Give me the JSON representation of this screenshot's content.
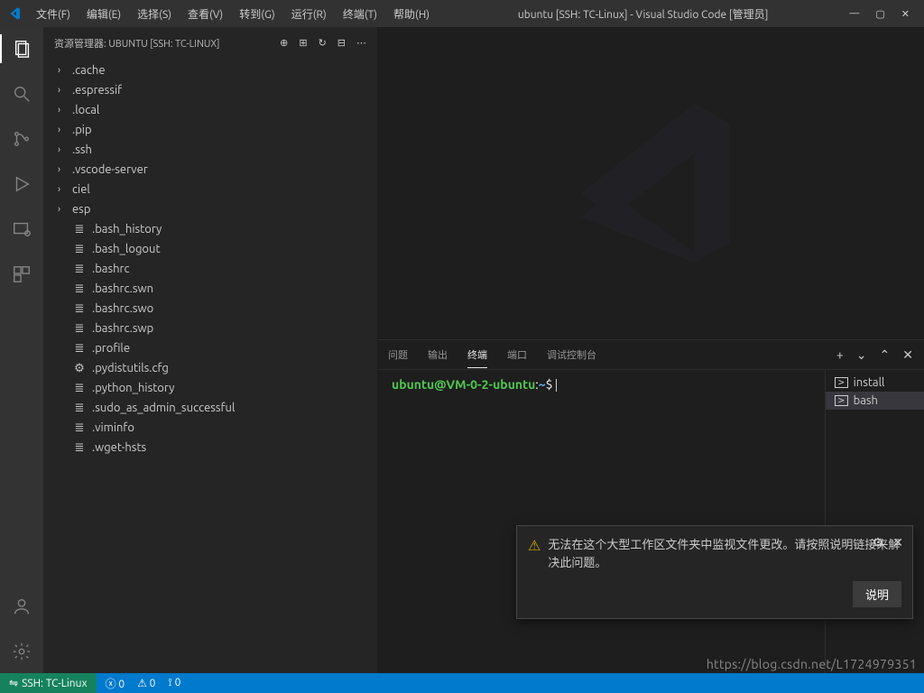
{
  "titlebar": {
    "title": "ubuntu [SSH: TC-Linux] - Visual Studio Code [管理员]",
    "menus": [
      "文件(F)",
      "编辑(E)",
      "选择(S)",
      "查看(V)",
      "转到(G)",
      "运行(R)",
      "终端(T)",
      "帮助(H)"
    ]
  },
  "sidebar": {
    "header": "资源管理器: UBUNTU [SSH: TC-LINUX]",
    "folders": [
      ".cache",
      ".espressif",
      ".local",
      ".pip",
      ".ssh",
      ".vscode-server",
      "ciel",
      "esp"
    ],
    "files": [
      ".bash_history",
      ".bash_logout",
      ".bashrc",
      ".bashrc.swn",
      ".bashrc.swo",
      ".bashrc.swp",
      ".profile",
      ".pydistutils.cfg",
      ".python_history",
      ".sudo_as_admin_successful",
      ".viminfo",
      ".wget-hsts"
    ]
  },
  "panel": {
    "tabs": {
      "problems": "问题",
      "output": "输出",
      "terminal": "终端",
      "ports": "端口",
      "debugconsole": "调试控制台"
    },
    "terminal": {
      "prompt_user": "ubuntu@VM-0-2-ubuntu",
      "prompt_sep": ":",
      "prompt_path": "~",
      "prompt_dollar": "$",
      "sessions": [
        "install",
        "bash"
      ]
    }
  },
  "notification": {
    "text": "无法在这个大型工作区文件夹中监视文件更改。请按照说明链接来解决此问题。",
    "button": "说明"
  },
  "statusbar": {
    "remote": "SSH: TC-Linux",
    "errors": "0",
    "warnings": "0",
    "radio": "0"
  },
  "watermark": "https://blog.csdn.net/L1724979351"
}
